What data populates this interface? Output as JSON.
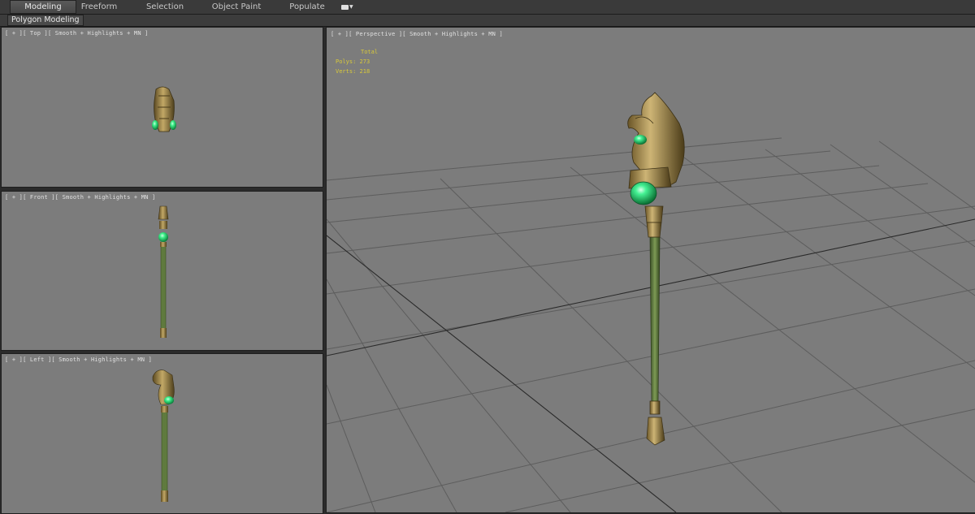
{
  "ribbon": {
    "tabs": [
      {
        "label": "Modeling",
        "active": true
      },
      {
        "label": "Freeform",
        "active": false
      },
      {
        "label": "Selection",
        "active": false
      },
      {
        "label": "Object Paint",
        "active": false
      },
      {
        "label": "Populate",
        "active": false
      }
    ],
    "panel_label": "Polygon Modeling"
  },
  "viewports": {
    "top": {
      "label": "[ + ][ Top ][ Smooth + Highlights + MN ]"
    },
    "front": {
      "label": "[ + ][ Front ][ Smooth + Highlights + MN ]"
    },
    "left": {
      "label": "[ + ][ Left ][ Smooth + Highlights + MN ]"
    },
    "perspective": {
      "label": "[ + ][ Perspective ][ Smooth + Highlights + MN ]",
      "stats": {
        "header": "Total",
        "polys_label": "Polys:",
        "polys": "273",
        "verts_label": "Verts:",
        "verts": "218"
      }
    }
  },
  "colors": {
    "viewport_bg": "#7c7c7c",
    "grid_line": "#5e5e5e",
    "stats_text": "#d8c93a",
    "gem": "#2fe07a",
    "gold": "#a08a4a",
    "shaft": "#5f7a3e"
  }
}
